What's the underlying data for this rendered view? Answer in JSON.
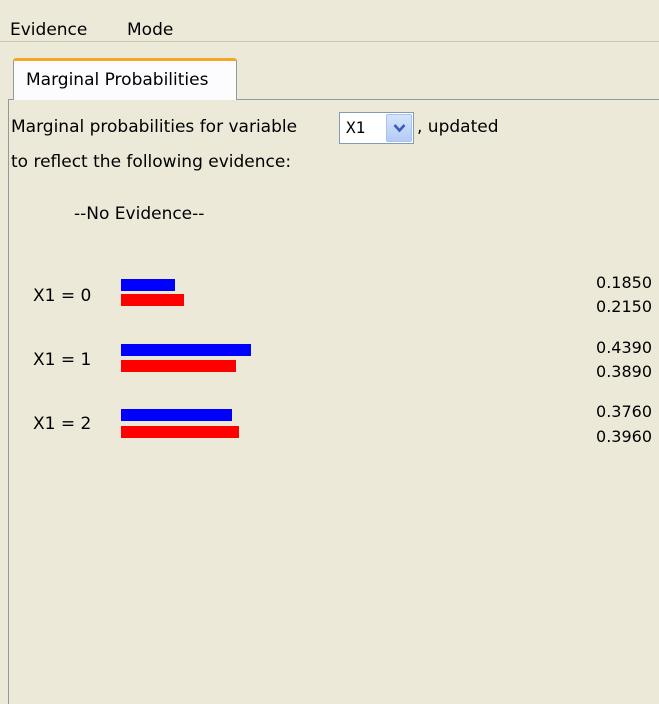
{
  "menu": {
    "evidence": "Evidence",
    "mode": "Mode"
  },
  "tab": {
    "label": "Marginal Probabilities"
  },
  "intro": {
    "before_combo": "Marginal probabilities for variable",
    "after_combo": ", updated",
    "line2": "to reflect the following evidence:"
  },
  "variable_select": {
    "value": "X1"
  },
  "evidence_text": "--No Evidence--",
  "colors": {
    "series_1": "#0000ff",
    "series_2": "#ff0000"
  },
  "rows": [
    {
      "label": "X1 = 0",
      "blue": "0.1850",
      "red": "0.2150"
    },
    {
      "label": "X1 = 1",
      "blue": "0.4390",
      "red": "0.3890"
    },
    {
      "label": "X1 = 2",
      "blue": "0.3760",
      "red": "0.3960"
    }
  ]
}
